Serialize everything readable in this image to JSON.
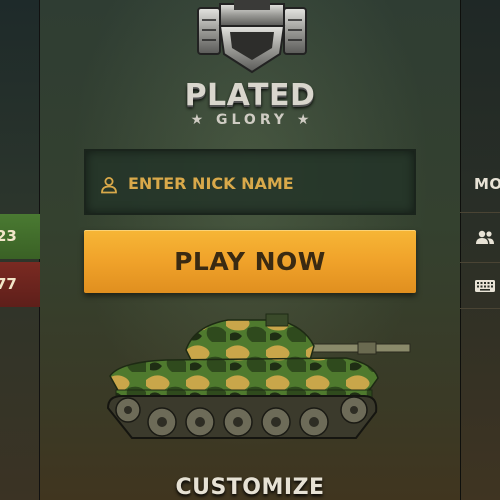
{
  "game": {
    "title": "PLATED",
    "subtitle": "★ GLORY ★"
  },
  "nick": {
    "placeholder": "ENTER NICK NAME",
    "value": ""
  },
  "buttons": {
    "play": "PLAY NOW",
    "customize": "CUSTOMIZE"
  },
  "left_panel": {
    "stat_green": "23",
    "stat_red": "77"
  },
  "right_panel": {
    "mode_label": "MO",
    "icons": [
      "users-icon",
      "keyboard-icon"
    ]
  },
  "colors": {
    "accent": "#f0a22a",
    "nick_text": "#d9a94a",
    "green_stat": "#4a7a32",
    "red_stat": "#7a2a22"
  }
}
